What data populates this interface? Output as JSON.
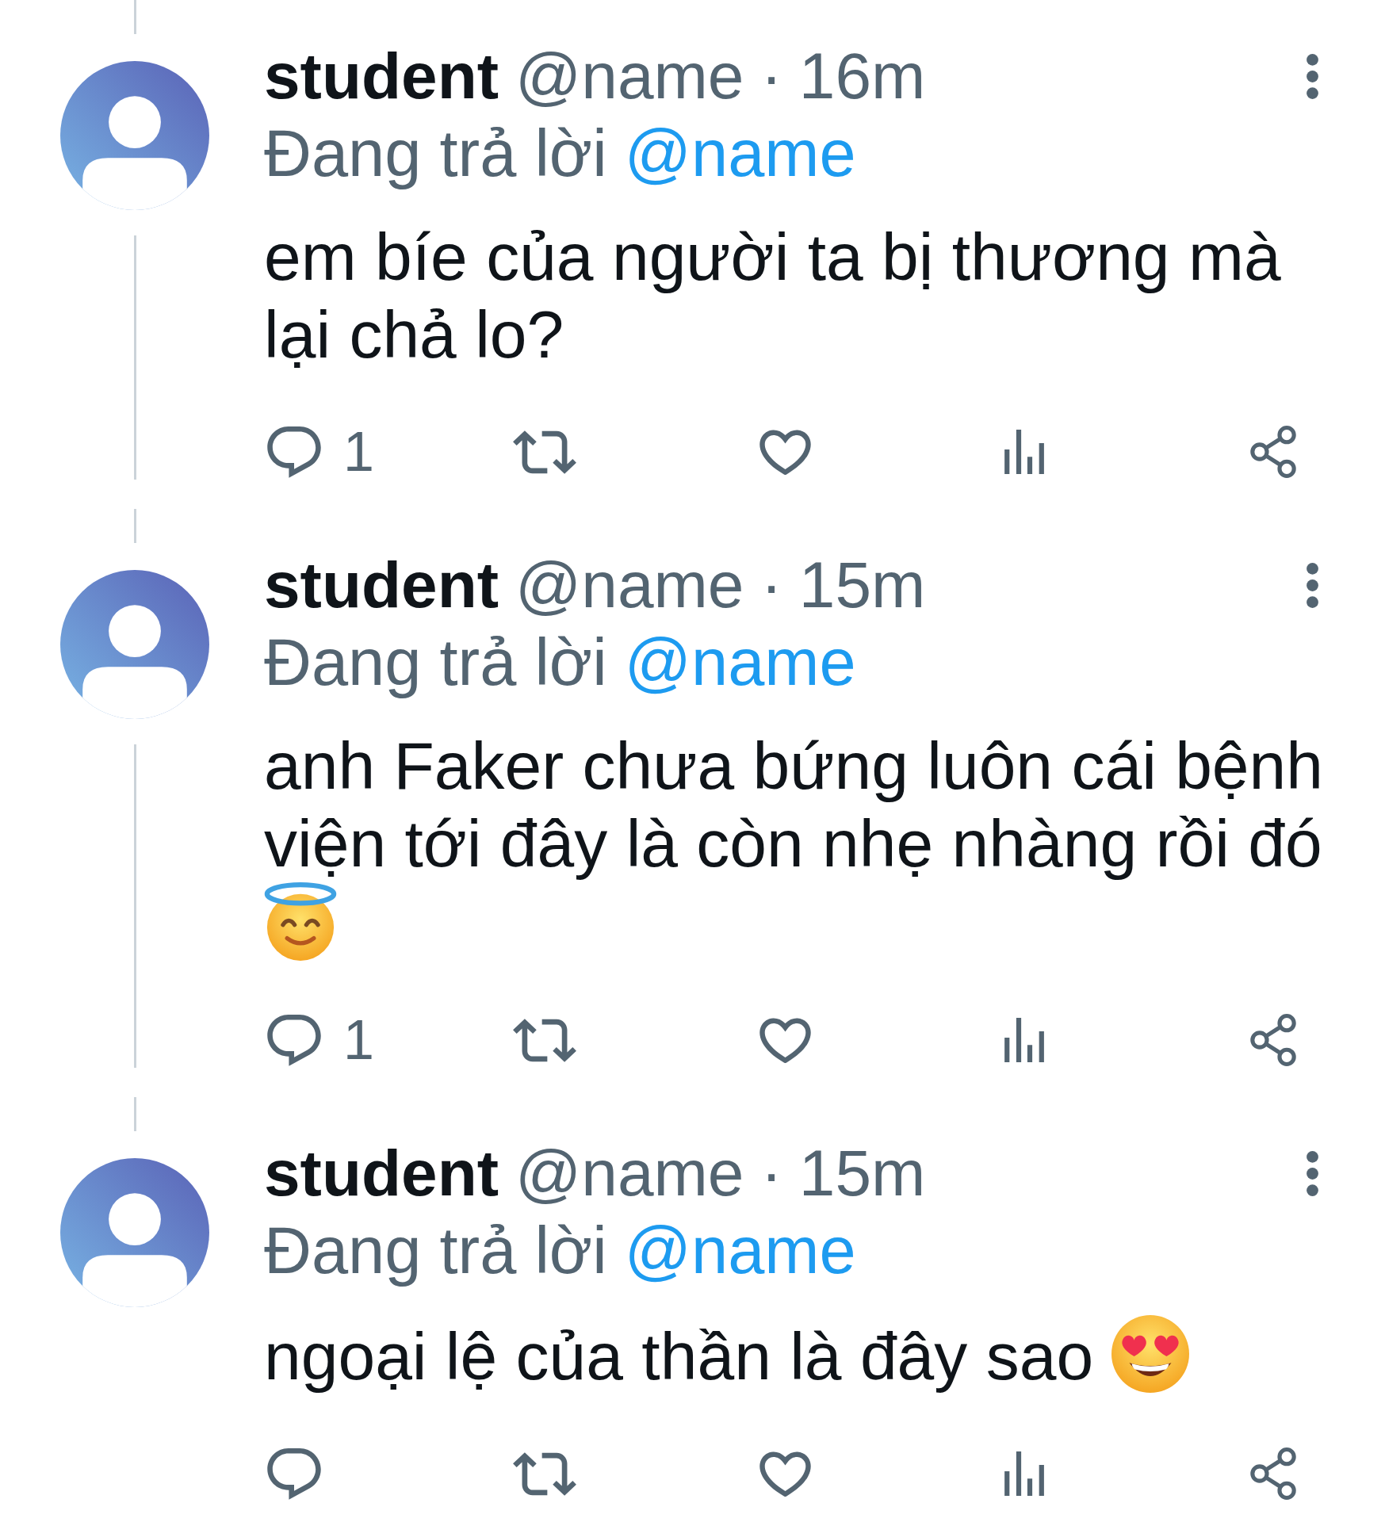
{
  "thread": {
    "tweets": [
      {
        "author": "student",
        "handle": "@name",
        "separator": "·",
        "time": "16m",
        "reply_label": "Đang trả lời",
        "reply_to": "@name",
        "text": "em bíe của người ta bị thương mà lại chả lo?",
        "actions": [
          {
            "kind": "reply",
            "count": "1"
          },
          {
            "kind": "repost"
          },
          {
            "kind": "like"
          },
          {
            "kind": "views"
          },
          {
            "kind": "share"
          }
        ]
      },
      {
        "author": "student",
        "handle": "@name",
        "separator": "·",
        "time": "15m",
        "reply_label": "Đang trả lời",
        "reply_to": "@name",
        "text": "anh Faker chưa bứng luôn cái bệnh viện tới đây là còn nhẹ nhàng rồi đó",
        "emoji": {
          "kind": "halo"
        },
        "actions": [
          {
            "kind": "reply",
            "count": "1"
          },
          {
            "kind": "repost"
          },
          {
            "kind": "like"
          },
          {
            "kind": "views"
          },
          {
            "kind": "share"
          }
        ]
      },
      {
        "author": "student",
        "handle": "@name",
        "separator": "·",
        "time": "15m",
        "reply_label": "Đang trả lời",
        "reply_to": "@name",
        "text": "ngoại lệ của thần là đây sao",
        "emoji": {
          "kind": "hearteyes"
        },
        "actions": [
          {
            "kind": "reply"
          },
          {
            "kind": "repost"
          },
          {
            "kind": "like"
          },
          {
            "kind": "views"
          },
          {
            "kind": "share"
          }
        ]
      }
    ]
  }
}
